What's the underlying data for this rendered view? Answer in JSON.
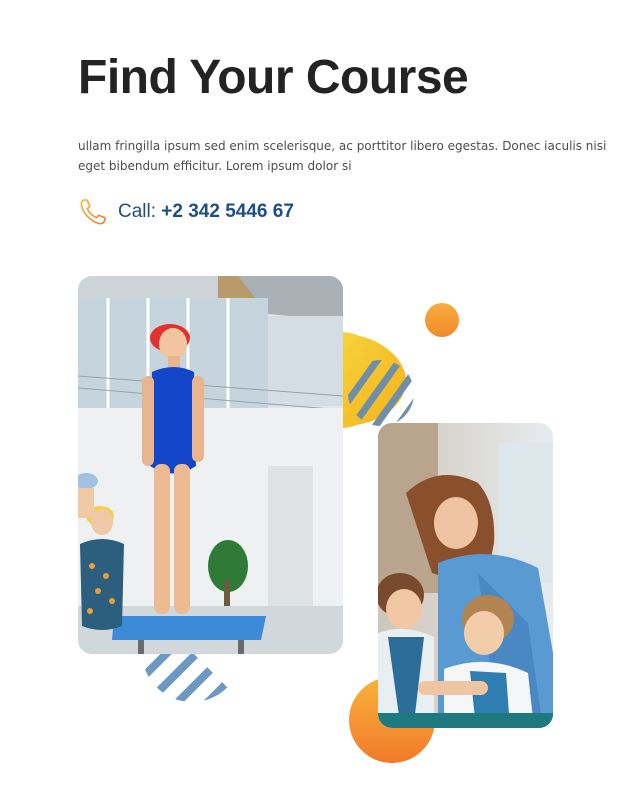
{
  "section": {
    "heading": "Find Your Course",
    "description": "ullam fringilla ipsum sed enim scelerisque, ac porttitor libero egestas. Donec iaculis nisi eget bibendum efficitur. Lorem ipsum dolor si",
    "call_label": "Call:",
    "call_number": "+2 342 5446 67",
    "call_icon": "phone-icon"
  },
  "colors": {
    "heading": "#232323",
    "body_text": "#4d4d4d",
    "accent_blue": "#1d4f85",
    "accent_orange": "#f08a24",
    "accent_yellow": "#f8c22a",
    "stripe_blue": "#6c98c4"
  },
  "media": {
    "images": [
      {
        "name": "swimmer-photo"
      },
      {
        "name": "classroom-photo"
      }
    ]
  }
}
